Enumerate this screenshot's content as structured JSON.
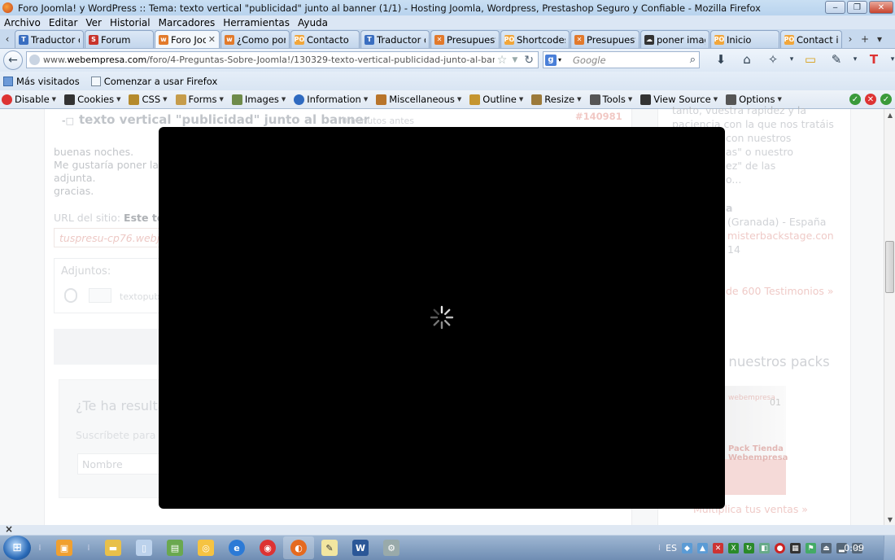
{
  "window": {
    "title": "Foro Joomla! y WordPress :: Tema: texto vertical \"publicidad\" junto al banner (1/1) - Hosting Joomla, Wordpress, Prestashop Seguro y Confiable - Mozilla Firefox",
    "minimize": "‒",
    "maximize": "❐",
    "close": "✕"
  },
  "menu": [
    "Archivo",
    "Editar",
    "Ver",
    "Historial",
    "Marcadores",
    "Herramientas",
    "Ayuda"
  ],
  "tabs": [
    {
      "label": "Traductor d...",
      "icon": "translate-icon"
    },
    {
      "label": "Forum",
      "icon": "forum-icon"
    },
    {
      "label": "Foro Joo...",
      "icon": "webempresa-icon",
      "active": true
    },
    {
      "label": "¿Como pon...",
      "icon": "webempresa-icon"
    },
    {
      "label": "Contacto",
      "icon": "po-icon"
    },
    {
      "label": "Traductor d...",
      "icon": "translate-icon"
    },
    {
      "label": "Presupuest...",
      "icon": "translate-icon"
    },
    {
      "label": "Shortcodes",
      "icon": "po-icon"
    },
    {
      "label": "Presupuest...",
      "icon": "translate-icon"
    },
    {
      "label": "poner imag...",
      "icon": "cloud-icon"
    },
    {
      "label": "Inicio",
      "icon": "po-icon"
    },
    {
      "label": "Contact item",
      "icon": "po-icon"
    }
  ],
  "tab_close": "✕",
  "nav": {
    "url_prefix": "www.",
    "url_domain": "webempresa.com",
    "url_path": "/foro/4-Preguntas-Sobre-Joomla!/130329-texto-vertical-publicidad-junto-al-banner.html#140981",
    "search_placeholder": "Google"
  },
  "bookmarks": [
    "Más visitados",
    "Comenzar a usar Firefox"
  ],
  "webdev": [
    "Disable",
    "Cookies",
    "CSS",
    "Forms",
    "Images",
    "Information",
    "Miscellaneous",
    "Outline",
    "Resize",
    "Tools",
    "View Source",
    "Options"
  ],
  "page": {
    "post_title": "texto vertical \"publicidad\" junto al banner",
    "post_meta": "0 minutos antes",
    "post_id": "#140981",
    "lines": [
      "buenas noches.",
      "Me gustaría poner la p",
      "adjunta.",
      "gracias."
    ],
    "site_label": "URL del sitio:",
    "site_label_bold": "Este tex",
    "site_value": "tuspresu-cp76.webjo",
    "attachments_title": "Adjuntos:",
    "attachment_file": "textopubli",
    "subscribe_q": "¿Te ha resultado",
    "subscribe_s": "Suscríbete para r",
    "name_placeholder": "Nombre",
    "right_lines": [
      "tanto, vuestra rapidez y la",
      "paciencia con la que nos tratáis",
      "con nuestros",
      "as\" o nuestro",
      "ez\" de las",
      "o..."
    ],
    "right_name": "a",
    "right_loc": "(Granada) - España",
    "right_site": "misterbackstage.con",
    "right_date": "14",
    "testimonials_link": "de 600 Testimonios »",
    "packs_heading": "e nuestros packs",
    "pack_brand": "webempresa",
    "pack_num": "01",
    "pack_title": "Pack Tienda Webempresa",
    "pack_link": "Multiplica tus ventas  »"
  },
  "taskbar": {
    "lang": "ES",
    "clock": "0:09"
  },
  "colors": {
    "modal": "#000000",
    "accent_link": "#e6aaa5"
  }
}
